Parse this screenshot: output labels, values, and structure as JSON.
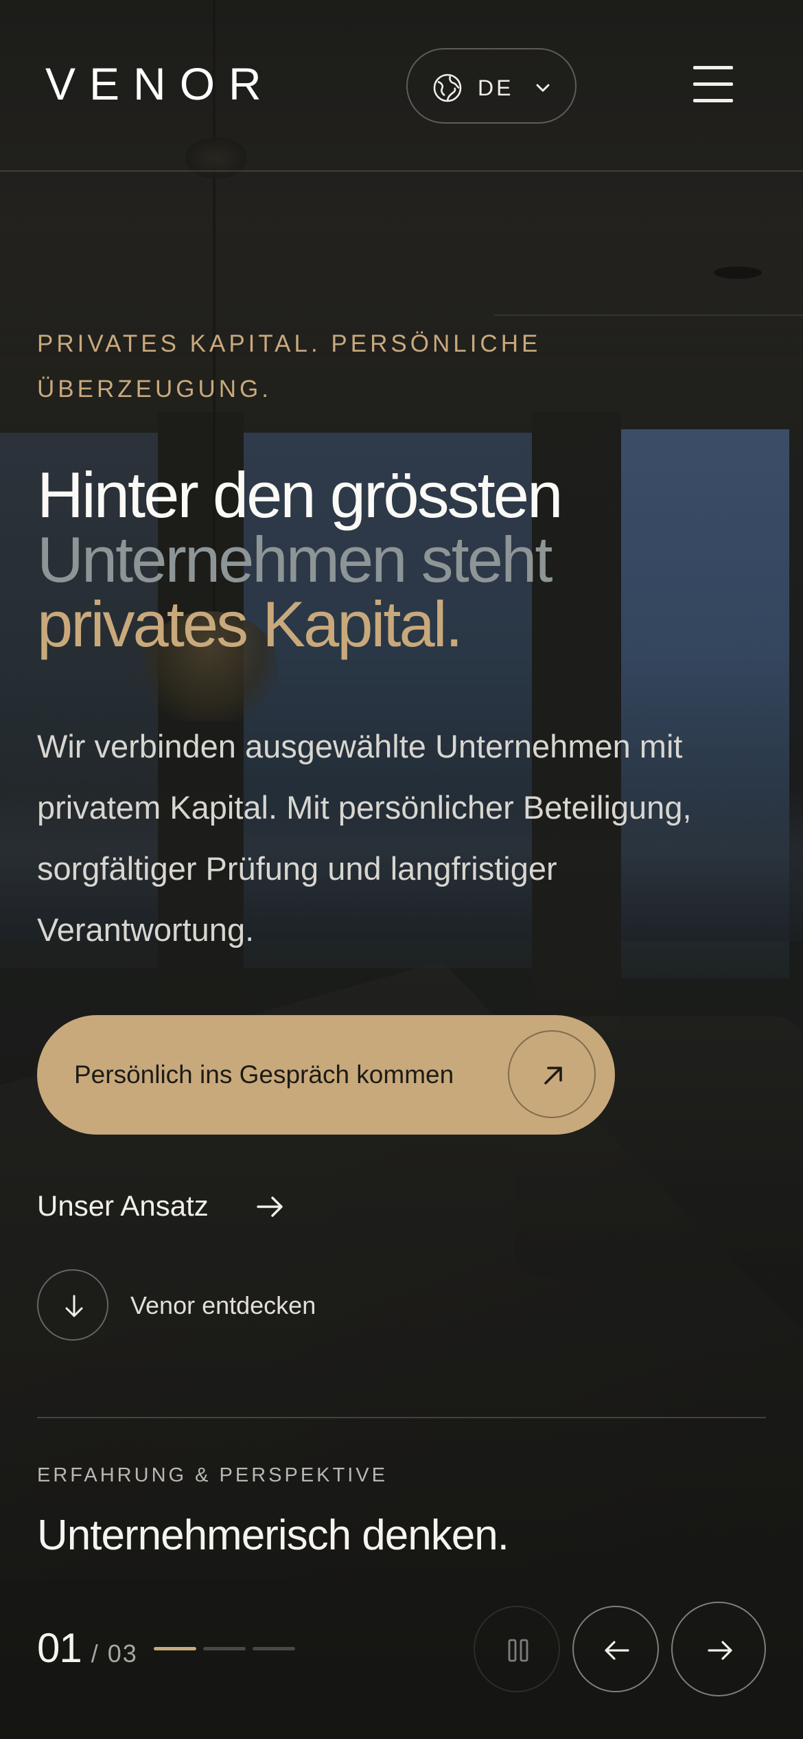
{
  "header": {
    "logo": "VENOR",
    "language": {
      "code": "DE"
    }
  },
  "hero": {
    "eyebrow": "PRIVATES KAPITAL. PERSÖNLICHE ÜBERZEUGUNG.",
    "headline": {
      "line1": "Hinter den grössten",
      "line2": "Unternehmen steht",
      "line3": "privates Kapital."
    },
    "lead": "Wir verbinden ausgewählte Unternehmen mit privatem Kapital. Mit persönlicher Beteiligung, sorgfältiger Prüfung und langfristiger Verantwortung.",
    "cta_label": "Persönlich ins Gespräch kommen",
    "approach_label": "Unser Ansatz",
    "discover_label": "Venor entdecken"
  },
  "section": {
    "label": "ERFAHRUNG & PERSPEKTIVE",
    "title": "Unternehmerisch denken."
  },
  "slider": {
    "current": "01",
    "total": "/ 03",
    "active_index": 0,
    "count": 3
  },
  "colors": {
    "accent": "#c8a97b",
    "background": "#1a1b17",
    "muted_text": "#8e9596"
  },
  "icons": [
    "globe-icon",
    "chevron-down-icon",
    "menu-icon",
    "arrow-up-right-icon",
    "arrow-right-icon",
    "arrow-down-icon",
    "pause-icon",
    "arrow-left-icon"
  ]
}
